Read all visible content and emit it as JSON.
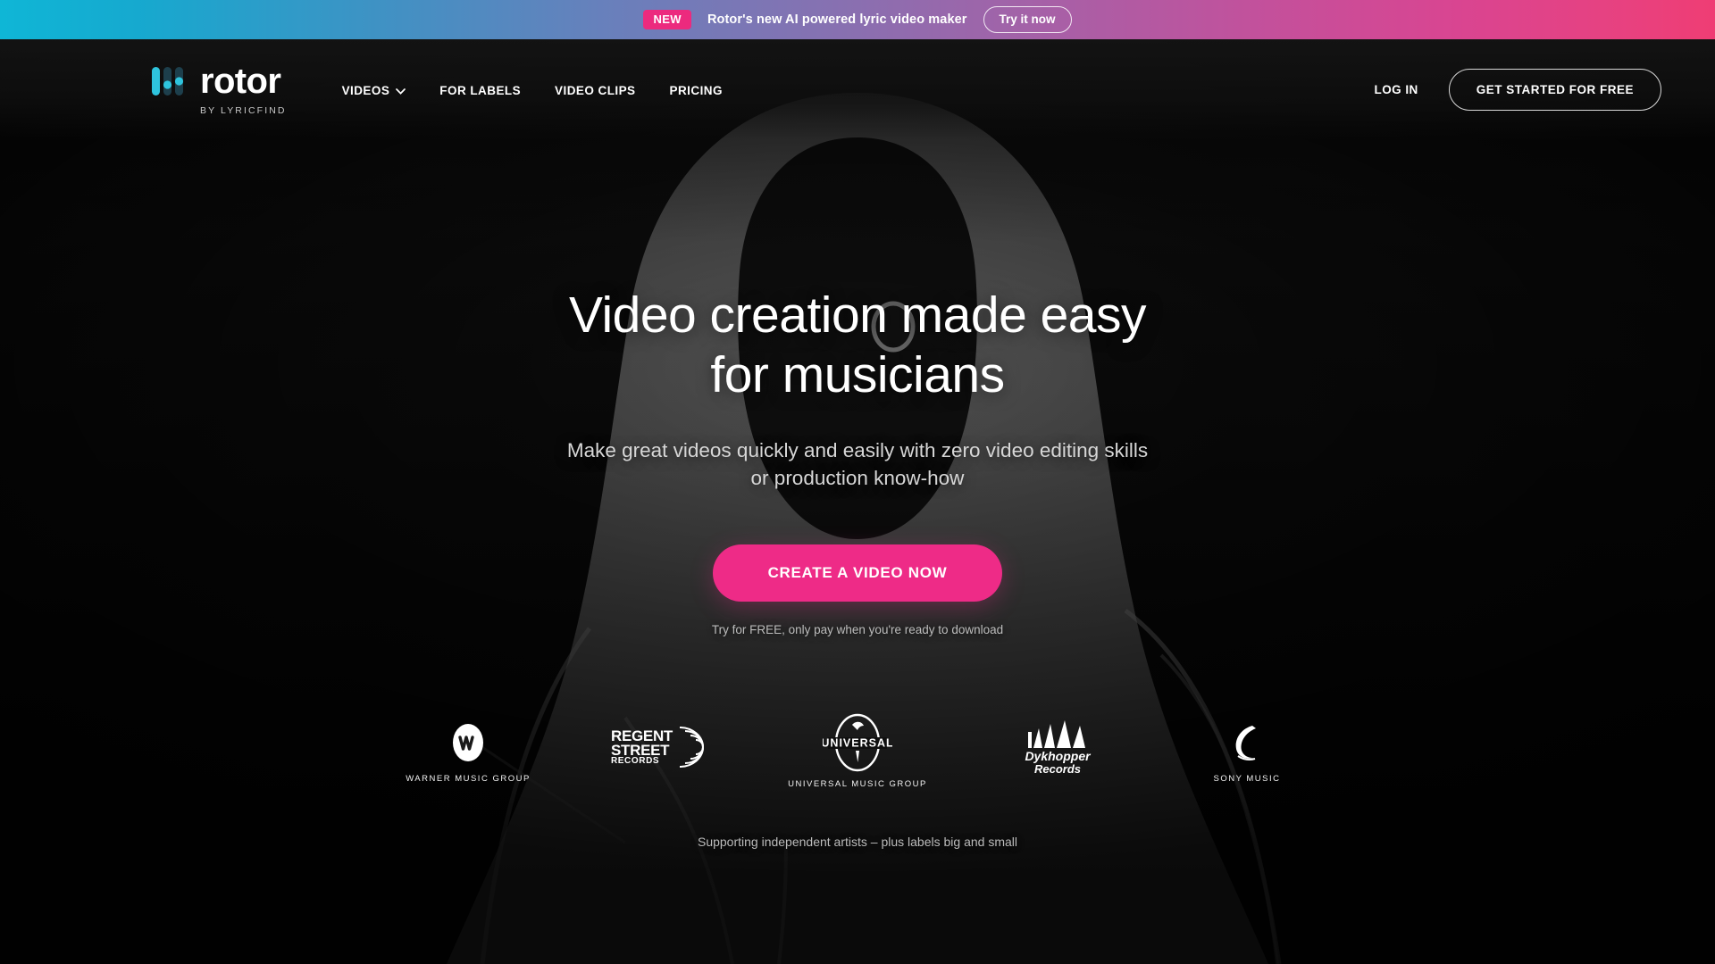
{
  "announcement": {
    "badge": "NEW",
    "message": "Rotor's new AI powered lyric video maker",
    "cta_label": "Try it now",
    "gradient_start": "#0fb6d6",
    "gradient_end": "#ef3d74",
    "badge_color": "#ec2a7e"
  },
  "brand": {
    "name": "rotor",
    "tagline": "BY LYRICFIND",
    "mark_color": "#2ec4dd"
  },
  "nav": {
    "links": [
      {
        "label": "VIDEOS",
        "icon": "chevron-down-icon",
        "has_dropdown": true
      },
      {
        "label": "FOR LABELS",
        "has_dropdown": false
      },
      {
        "label": "VIDEO CLIPS",
        "has_dropdown": false
      },
      {
        "label": "PRICING",
        "has_dropdown": false
      }
    ],
    "login_label": "LOG IN",
    "signup_label": "GET STARTED FOR FREE"
  },
  "hero": {
    "headline_line1": "Video creation made easy",
    "headline_line2": "for musicians",
    "subhead_line1": "Make great videos quickly and easily with zero video editing skills",
    "subhead_line2": "or production know-how",
    "cta_label": "CREATE A VIDEO NOW",
    "cta_color": "#ee2b87",
    "cta_note": "Try for FREE, only pay when you're ready to download"
  },
  "labels": {
    "note": "Supporting independent artists – plus labels big and small",
    "items": [
      {
        "name": "WARNER MUSIC GROUP",
        "icon": "warner-music-logo",
        "caption": "WARNER MUSIC GROUP"
      },
      {
        "name": "REGENT STREET RECORDS",
        "icon": "regent-street-records-logo",
        "caption": ""
      },
      {
        "name": "UNIVERSAL MUSIC GROUP",
        "icon": "universal-music-logo",
        "caption": "UNIVERSAL MUSIC GROUP"
      },
      {
        "name": "DYKHOPPER RECORDS",
        "icon": "dykhopper-records-logo",
        "caption": ""
      },
      {
        "name": "SONY MUSIC",
        "icon": "sony-music-logo",
        "caption": "SONY MUSIC"
      }
    ],
    "regent": {
      "line1": "REGENT",
      "line2": "STREET",
      "line3": "RECORDS"
    },
    "universal": {
      "word": "UNIVERSAL"
    },
    "dykhopper": {
      "line1": "Dykhopper",
      "line2": "Records"
    }
  }
}
